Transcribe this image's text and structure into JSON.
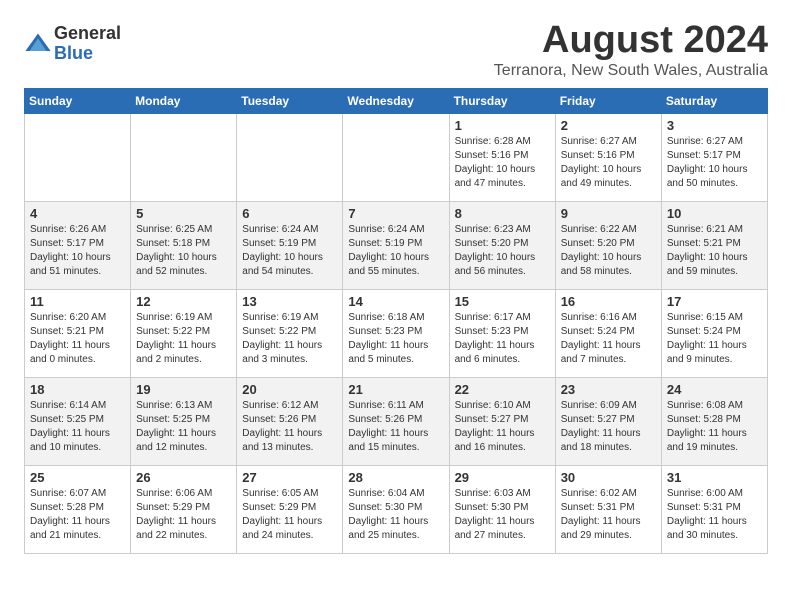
{
  "header": {
    "logo_general": "General",
    "logo_blue": "Blue",
    "month_year": "August 2024",
    "location": "Terranora, New South Wales, Australia"
  },
  "days_of_week": [
    "Sunday",
    "Monday",
    "Tuesday",
    "Wednesday",
    "Thursday",
    "Friday",
    "Saturday"
  ],
  "weeks": [
    [
      {
        "day": "",
        "content": ""
      },
      {
        "day": "",
        "content": ""
      },
      {
        "day": "",
        "content": ""
      },
      {
        "day": "",
        "content": ""
      },
      {
        "day": "1",
        "content": "Sunrise: 6:28 AM\nSunset: 5:16 PM\nDaylight: 10 hours\nand 47 minutes."
      },
      {
        "day": "2",
        "content": "Sunrise: 6:27 AM\nSunset: 5:16 PM\nDaylight: 10 hours\nand 49 minutes."
      },
      {
        "day": "3",
        "content": "Sunrise: 6:27 AM\nSunset: 5:17 PM\nDaylight: 10 hours\nand 50 minutes."
      }
    ],
    [
      {
        "day": "4",
        "content": "Sunrise: 6:26 AM\nSunset: 5:17 PM\nDaylight: 10 hours\nand 51 minutes."
      },
      {
        "day": "5",
        "content": "Sunrise: 6:25 AM\nSunset: 5:18 PM\nDaylight: 10 hours\nand 52 minutes."
      },
      {
        "day": "6",
        "content": "Sunrise: 6:24 AM\nSunset: 5:19 PM\nDaylight: 10 hours\nand 54 minutes."
      },
      {
        "day": "7",
        "content": "Sunrise: 6:24 AM\nSunset: 5:19 PM\nDaylight: 10 hours\nand 55 minutes."
      },
      {
        "day": "8",
        "content": "Sunrise: 6:23 AM\nSunset: 5:20 PM\nDaylight: 10 hours\nand 56 minutes."
      },
      {
        "day": "9",
        "content": "Sunrise: 6:22 AM\nSunset: 5:20 PM\nDaylight: 10 hours\nand 58 minutes."
      },
      {
        "day": "10",
        "content": "Sunrise: 6:21 AM\nSunset: 5:21 PM\nDaylight: 10 hours\nand 59 minutes."
      }
    ],
    [
      {
        "day": "11",
        "content": "Sunrise: 6:20 AM\nSunset: 5:21 PM\nDaylight: 11 hours\nand 0 minutes."
      },
      {
        "day": "12",
        "content": "Sunrise: 6:19 AM\nSunset: 5:22 PM\nDaylight: 11 hours\nand 2 minutes."
      },
      {
        "day": "13",
        "content": "Sunrise: 6:19 AM\nSunset: 5:22 PM\nDaylight: 11 hours\nand 3 minutes."
      },
      {
        "day": "14",
        "content": "Sunrise: 6:18 AM\nSunset: 5:23 PM\nDaylight: 11 hours\nand 5 minutes."
      },
      {
        "day": "15",
        "content": "Sunrise: 6:17 AM\nSunset: 5:23 PM\nDaylight: 11 hours\nand 6 minutes."
      },
      {
        "day": "16",
        "content": "Sunrise: 6:16 AM\nSunset: 5:24 PM\nDaylight: 11 hours\nand 7 minutes."
      },
      {
        "day": "17",
        "content": "Sunrise: 6:15 AM\nSunset: 5:24 PM\nDaylight: 11 hours\nand 9 minutes."
      }
    ],
    [
      {
        "day": "18",
        "content": "Sunrise: 6:14 AM\nSunset: 5:25 PM\nDaylight: 11 hours\nand 10 minutes."
      },
      {
        "day": "19",
        "content": "Sunrise: 6:13 AM\nSunset: 5:25 PM\nDaylight: 11 hours\nand 12 minutes."
      },
      {
        "day": "20",
        "content": "Sunrise: 6:12 AM\nSunset: 5:26 PM\nDaylight: 11 hours\nand 13 minutes."
      },
      {
        "day": "21",
        "content": "Sunrise: 6:11 AM\nSunset: 5:26 PM\nDaylight: 11 hours\nand 15 minutes."
      },
      {
        "day": "22",
        "content": "Sunrise: 6:10 AM\nSunset: 5:27 PM\nDaylight: 11 hours\nand 16 minutes."
      },
      {
        "day": "23",
        "content": "Sunrise: 6:09 AM\nSunset: 5:27 PM\nDaylight: 11 hours\nand 18 minutes."
      },
      {
        "day": "24",
        "content": "Sunrise: 6:08 AM\nSunset: 5:28 PM\nDaylight: 11 hours\nand 19 minutes."
      }
    ],
    [
      {
        "day": "25",
        "content": "Sunrise: 6:07 AM\nSunset: 5:28 PM\nDaylight: 11 hours\nand 21 minutes."
      },
      {
        "day": "26",
        "content": "Sunrise: 6:06 AM\nSunset: 5:29 PM\nDaylight: 11 hours\nand 22 minutes."
      },
      {
        "day": "27",
        "content": "Sunrise: 6:05 AM\nSunset: 5:29 PM\nDaylight: 11 hours\nand 24 minutes."
      },
      {
        "day": "28",
        "content": "Sunrise: 6:04 AM\nSunset: 5:30 PM\nDaylight: 11 hours\nand 25 minutes."
      },
      {
        "day": "29",
        "content": "Sunrise: 6:03 AM\nSunset: 5:30 PM\nDaylight: 11 hours\nand 27 minutes."
      },
      {
        "day": "30",
        "content": "Sunrise: 6:02 AM\nSunset: 5:31 PM\nDaylight: 11 hours\nand 29 minutes."
      },
      {
        "day": "31",
        "content": "Sunrise: 6:00 AM\nSunset: 5:31 PM\nDaylight: 11 hours\nand 30 minutes."
      }
    ]
  ]
}
